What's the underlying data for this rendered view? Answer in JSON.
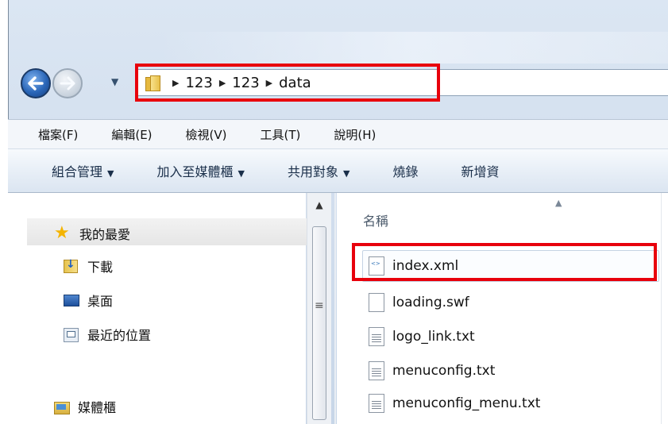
{
  "address_bar": {
    "crumbs": [
      "123",
      "123",
      "data"
    ]
  },
  "menu": {
    "items": [
      "檔案(F)",
      "編輯(E)",
      "檢視(V)",
      "工具(T)",
      "說明(H)"
    ]
  },
  "toolbar": {
    "organize": "組合管理",
    "add_to_library": "加入至媒體櫃",
    "share_with": "共用對象",
    "burn": "燒錄",
    "new_folder": "新增資"
  },
  "nav_pane": {
    "favorites": "我的最愛",
    "downloads": "下載",
    "desktop": "桌面",
    "recent_places": "最近的位置",
    "libraries": "媒體櫃"
  },
  "file_list": {
    "column_name": "名稱",
    "files": [
      "index.xml",
      "loading.swf",
      "logo_link.txt",
      "menuconfig.txt",
      "menuconfig_menu.txt"
    ]
  },
  "colors": {
    "highlight": "#e8000c",
    "toolbar_text": "#1a2f4a"
  }
}
